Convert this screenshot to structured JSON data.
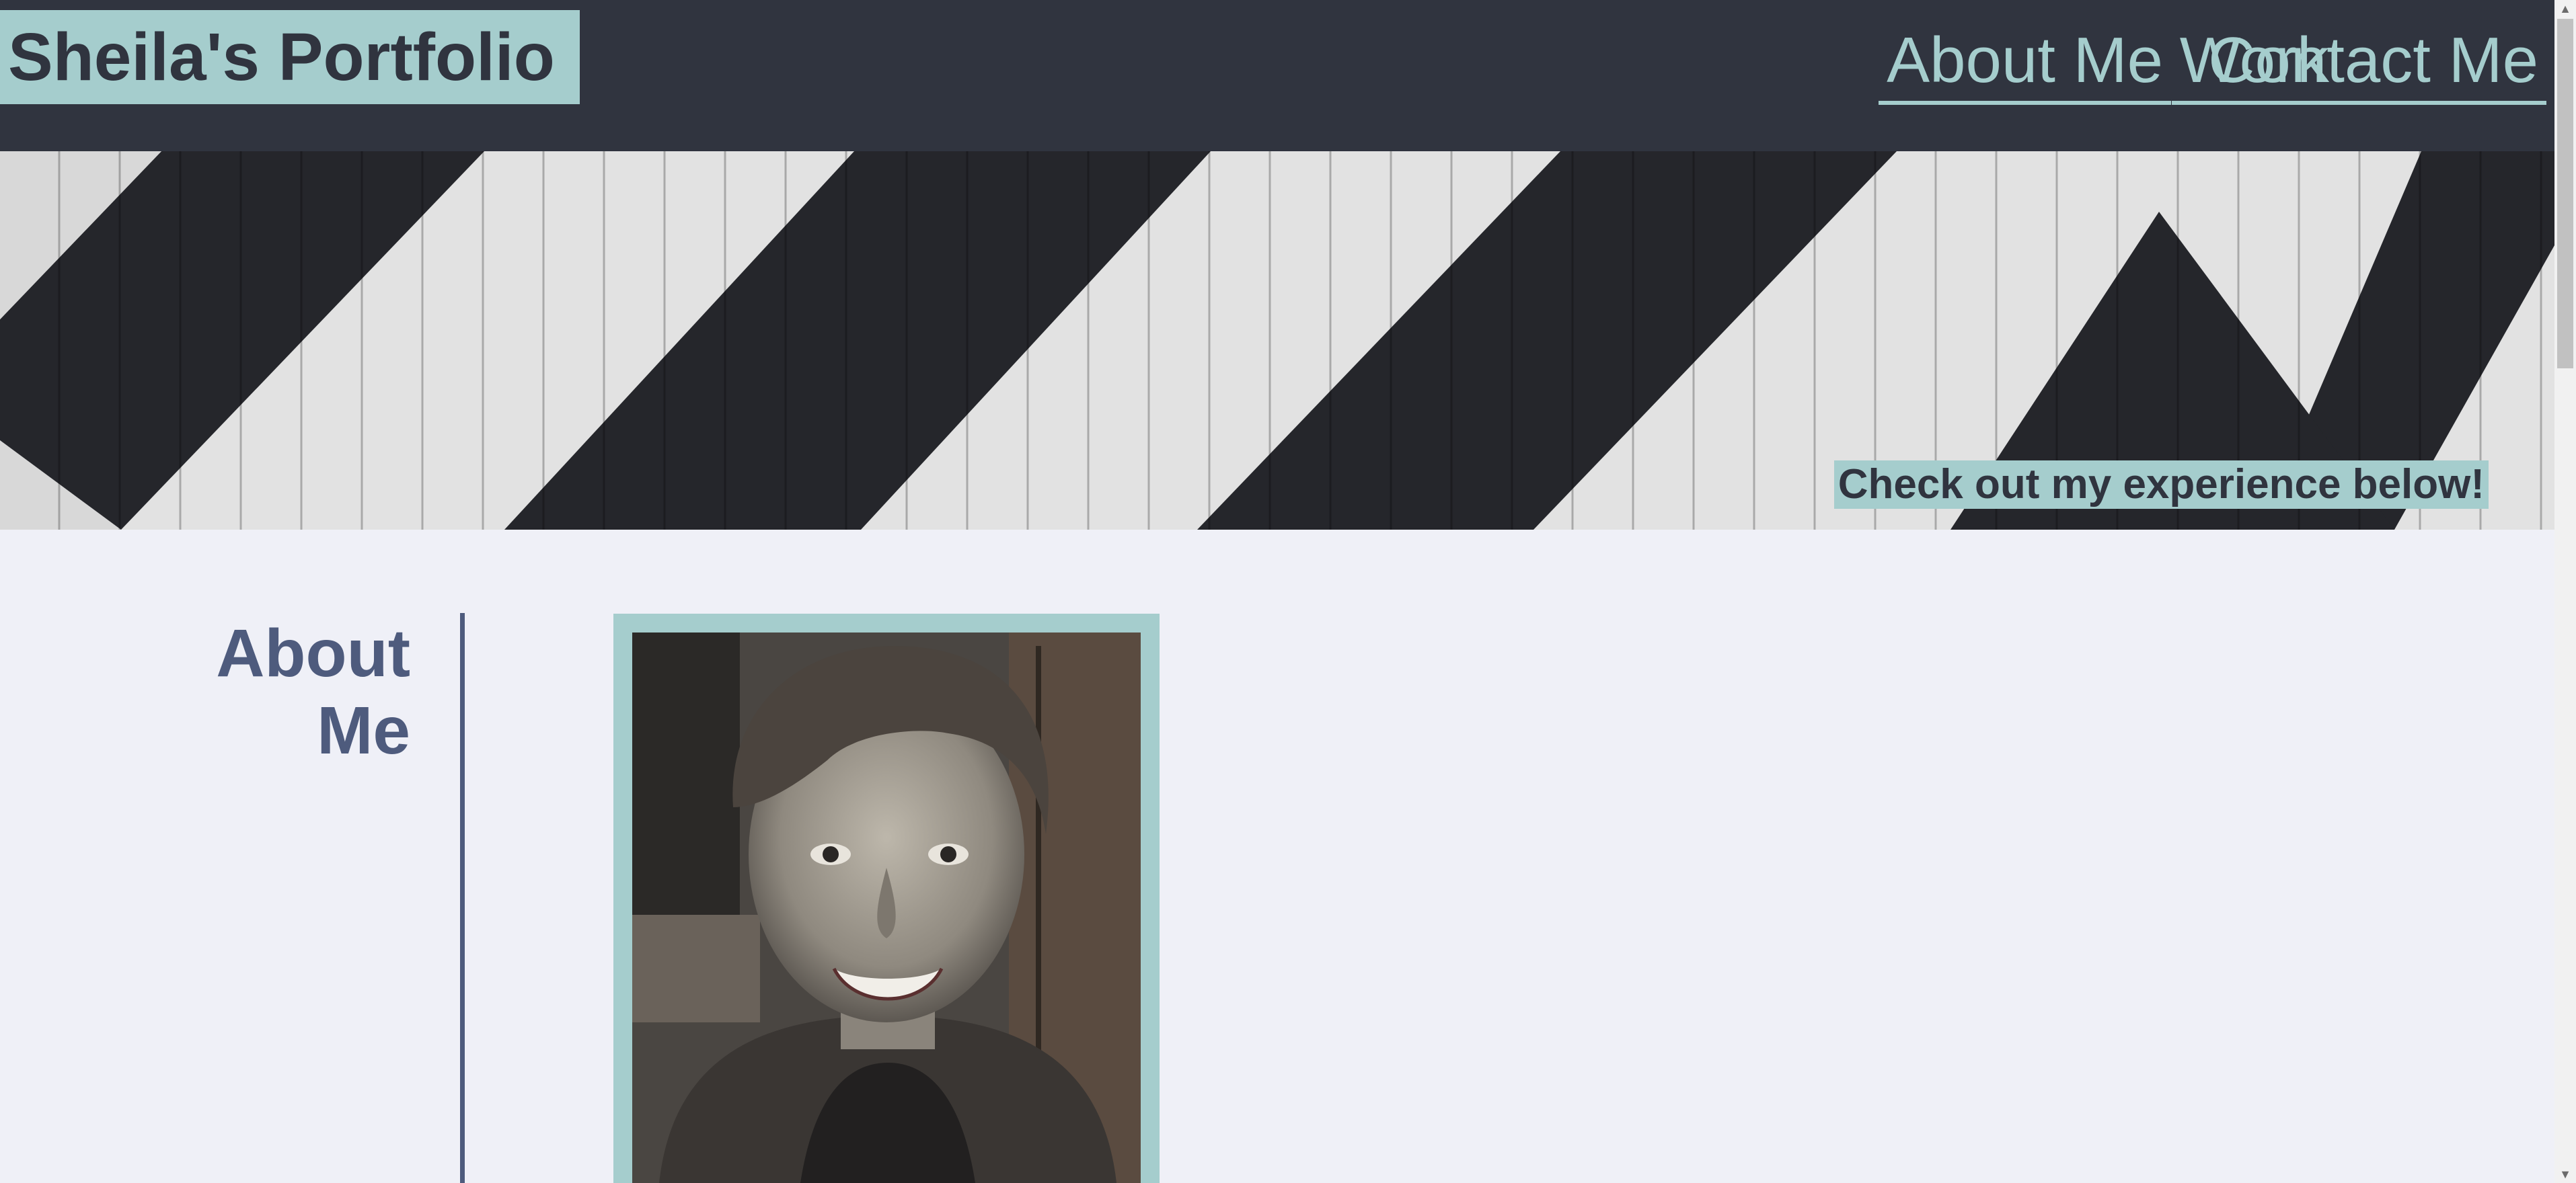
{
  "header": {
    "brand": "Sheila's Portfolio",
    "nav": [
      {
        "label": "About Me"
      },
      {
        "label": "Work"
      },
      {
        "label": "Contact Me"
      }
    ]
  },
  "hero": {
    "tagline": "Check out my experience below!"
  },
  "about": {
    "title_line1": "About",
    "title_line2": "Me"
  },
  "colors": {
    "header_bg": "#30343f",
    "accent": "#a5cdcd",
    "page_bg": "#eff0f7",
    "heading": "#4e5b7d"
  }
}
